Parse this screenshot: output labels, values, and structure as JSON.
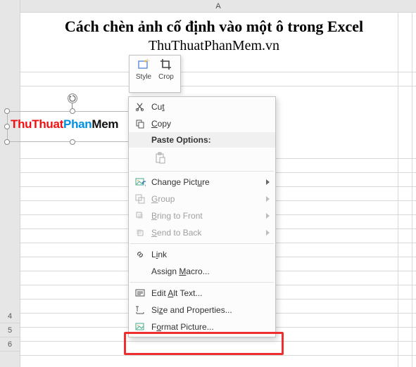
{
  "column_header": "A",
  "row_markers": [
    "4",
    "5",
    "6"
  ],
  "cell": {
    "title_line1": "Cách chèn ảnh cố định vào một ô trong Excel",
    "title_line2": "ThuThuatPhanMem.vn"
  },
  "mini_toolbar": {
    "style_label": "Style",
    "crop_label": "Crop"
  },
  "picture_logo": {
    "part1": "ThuThuat",
    "part2": "Phan",
    "part3": "Mem"
  },
  "context_menu": {
    "cut": "Cut",
    "copy": "Copy",
    "paste_options_title": "Paste Options:",
    "change_picture": "Change Picture",
    "group": "Group",
    "bring_to_front": "Bring to Front",
    "send_to_back": "Send to Back",
    "link": "Link",
    "assign_macro": "Assign Macro...",
    "edit_alt_text": "Edit Alt Text...",
    "size_and_properties": "Size and Properties...",
    "format_picture": "Format Picture..."
  }
}
